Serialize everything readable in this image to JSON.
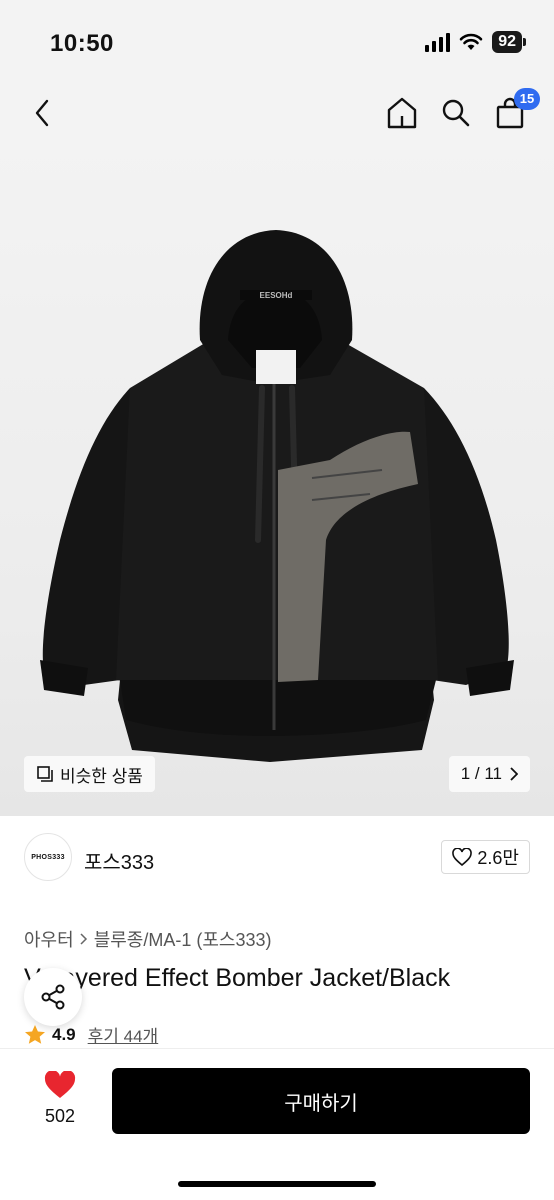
{
  "status": {
    "time": "10:50",
    "battery": "92"
  },
  "nav": {
    "cart_count": "15"
  },
  "gallery": {
    "similar_label": "비슷한 상품",
    "page": "1 / 11"
  },
  "brand": {
    "logo_text": "PHOS333",
    "name": "포스333",
    "likes": "2.6만"
  },
  "product": {
    "category_main": "아우터",
    "category_sub": "블루종/MA-1 (포스333)",
    "title": "V Layered Effect Bomber Jacket/Black",
    "rating": "4.9",
    "reviews": "후기 44개"
  },
  "bottom": {
    "wishlist_count": "502",
    "buy_label": "구매하기"
  },
  "colors": {
    "accent_badge": "#2f6bf0",
    "heart": "#e8262f",
    "buy_button": "#000000"
  }
}
